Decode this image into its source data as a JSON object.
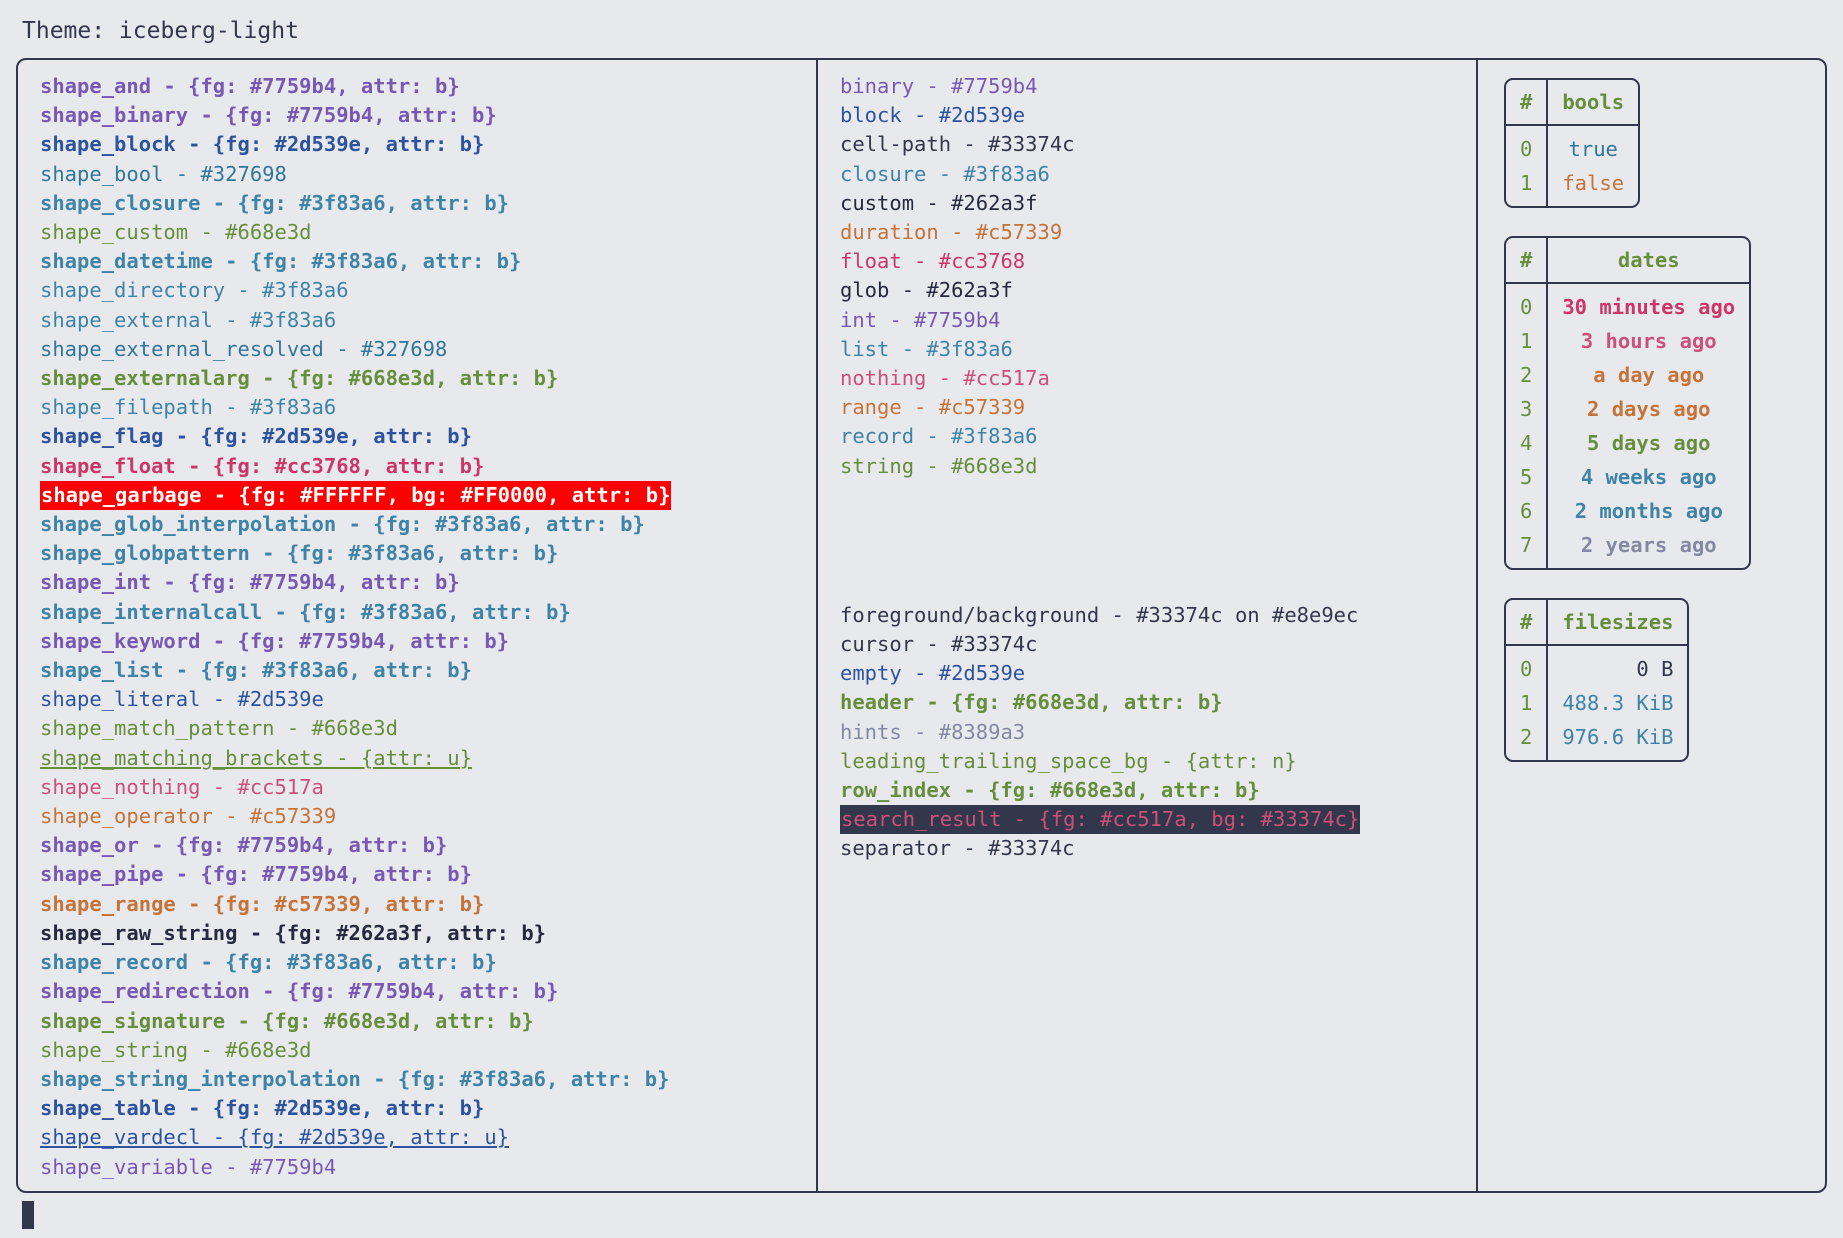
{
  "header": {
    "theme_label": "Theme: iceberg-light"
  },
  "palette": {
    "bg": "#e8e9ec",
    "fg": "#33374c",
    "purple": "#7759b4",
    "blue": "#2d539e",
    "teal": "#327698",
    "cyan": "#3f83a6",
    "green": "#668e3d",
    "pink": "#cc3768",
    "red_pink": "#cc517a",
    "orange": "#c57339",
    "black": "#262a3f",
    "grey": "#8389a3",
    "garbage_fg": "#FFFFFF",
    "garbage_bg": "#FF0000",
    "search_fg": "#cc517a",
    "search_bg": "#33374c"
  },
  "shapes_column": [
    {
      "text": "shape_and - {fg: #7759b4, attr: b}",
      "color": "#7759b4",
      "bold": true
    },
    {
      "text": "shape_binary - {fg: #7759b4, attr: b}",
      "color": "#7759b4",
      "bold": true
    },
    {
      "text": "shape_block - {fg: #2d539e, attr: b}",
      "color": "#2d539e",
      "bold": true
    },
    {
      "text": "shape_bool - #327698",
      "color": "#327698",
      "bold": false
    },
    {
      "text": "shape_closure - {fg: #3f83a6, attr: b}",
      "color": "#3f83a6",
      "bold": true
    },
    {
      "text": "shape_custom - #668e3d",
      "color": "#668e3d",
      "bold": false
    },
    {
      "text": "shape_datetime - {fg: #3f83a6, attr: b}",
      "color": "#3f83a6",
      "bold": true
    },
    {
      "text": "shape_directory - #3f83a6",
      "color": "#3f83a6",
      "bold": false
    },
    {
      "text": "shape_external - #3f83a6",
      "color": "#3f83a6",
      "bold": false
    },
    {
      "text": "shape_external_resolved - #327698",
      "color": "#327698",
      "bold": false
    },
    {
      "text": "shape_externalarg - {fg: #668e3d, attr: b}",
      "color": "#668e3d",
      "bold": true
    },
    {
      "text": "shape_filepath - #3f83a6",
      "color": "#3f83a6",
      "bold": false
    },
    {
      "text": "shape_flag - {fg: #2d539e, attr: b}",
      "color": "#2d539e",
      "bold": true
    },
    {
      "text": "shape_float - {fg: #cc3768, attr: b}",
      "color": "#cc3768",
      "bold": true
    },
    {
      "text": "shape_garbage - {fg: #FFFFFF, bg: #FF0000, attr: b}",
      "color": "#FFFFFF",
      "bg": "#FF0000",
      "bold": true
    },
    {
      "text": "shape_glob_interpolation - {fg: #3f83a6, attr: b}",
      "color": "#3f83a6",
      "bold": true
    },
    {
      "text": "shape_globpattern - {fg: #3f83a6, attr: b}",
      "color": "#3f83a6",
      "bold": true
    },
    {
      "text": "shape_int - {fg: #7759b4, attr: b}",
      "color": "#7759b4",
      "bold": true
    },
    {
      "text": "shape_internalcall - {fg: #3f83a6, attr: b}",
      "color": "#3f83a6",
      "bold": true
    },
    {
      "text": "shape_keyword - {fg: #7759b4, attr: b}",
      "color": "#7759b4",
      "bold": true
    },
    {
      "text": "shape_list - {fg: #3f83a6, attr: b}",
      "color": "#3f83a6",
      "bold": true
    },
    {
      "text": "shape_literal - #2d539e",
      "color": "#2d539e",
      "bold": false
    },
    {
      "text": "shape_match_pattern - #668e3d",
      "color": "#668e3d",
      "bold": false
    },
    {
      "text": "shape_matching_brackets - {attr: u}",
      "color": "#668e3d",
      "bold": false,
      "underline": true
    },
    {
      "text": "shape_nothing - #cc517a",
      "color": "#cc517a",
      "bold": false
    },
    {
      "text": "shape_operator - #c57339",
      "color": "#c57339",
      "bold": false
    },
    {
      "text": "shape_or - {fg: #7759b4, attr: b}",
      "color": "#7759b4",
      "bold": true
    },
    {
      "text": "shape_pipe - {fg: #7759b4, attr: b}",
      "color": "#7759b4",
      "bold": true
    },
    {
      "text": "shape_range - {fg: #c57339, attr: b}",
      "color": "#c57339",
      "bold": true
    },
    {
      "text": "shape_raw_string - {fg: #262a3f, attr: b}",
      "color": "#262a3f",
      "bold": true
    },
    {
      "text": "shape_record - {fg: #3f83a6, attr: b}",
      "color": "#3f83a6",
      "bold": true
    },
    {
      "text": "shape_redirection - {fg: #7759b4, attr: b}",
      "color": "#7759b4",
      "bold": true
    },
    {
      "text": "shape_signature - {fg: #668e3d, attr: b}",
      "color": "#668e3d",
      "bold": true
    },
    {
      "text": "shape_string - #668e3d",
      "color": "#668e3d",
      "bold": false
    },
    {
      "text": "shape_string_interpolation - {fg: #3f83a6, attr: b}",
      "color": "#3f83a6",
      "bold": true
    },
    {
      "text": "shape_table - {fg: #2d539e, attr: b}",
      "color": "#2d539e",
      "bold": true
    },
    {
      "text": "shape_vardecl - {fg: #2d539e, attr: u}",
      "color": "#2d539e",
      "bold": false,
      "underline": true
    },
    {
      "text": "shape_variable - #7759b4",
      "color": "#7759b4",
      "bold": false
    }
  ],
  "types_column": [
    {
      "text": "binary - #7759b4",
      "color": "#7759b4",
      "bold": false
    },
    {
      "text": "block - #2d539e",
      "color": "#2d539e",
      "bold": false
    },
    {
      "text": "cell-path - #33374c",
      "color": "#33374c",
      "bold": false
    },
    {
      "text": "closure - #3f83a6",
      "color": "#3f83a6",
      "bold": false
    },
    {
      "text": "custom - #262a3f",
      "color": "#262a3f",
      "bold": false
    },
    {
      "text": "duration - #c57339",
      "color": "#c57339",
      "bold": false
    },
    {
      "text": "float - #cc3768",
      "color": "#cc3768",
      "bold": false
    },
    {
      "text": "glob - #262a3f",
      "color": "#262a3f",
      "bold": false
    },
    {
      "text": "int - #7759b4",
      "color": "#7759b4",
      "bold": false
    },
    {
      "text": "list - #3f83a6",
      "color": "#3f83a6",
      "bold": false
    },
    {
      "text": "nothing - #cc517a",
      "color": "#cc517a",
      "bold": false
    },
    {
      "text": "range - #c57339",
      "color": "#c57339",
      "bold": false
    },
    {
      "text": "record - #3f83a6",
      "color": "#3f83a6",
      "bold": false
    },
    {
      "text": "string - #668e3d",
      "color": "#668e3d",
      "bold": false
    }
  ],
  "ui_column": [
    {
      "text": "foreground/background - #33374c on #e8e9ec",
      "color": "#33374c",
      "bold": false
    },
    {
      "text": "cursor - #33374c",
      "color": "#33374c",
      "bold": false
    },
    {
      "text": "empty - #2d539e",
      "color": "#2d539e",
      "bold": false
    },
    {
      "text": "header - {fg: #668e3d, attr: b}",
      "color": "#668e3d",
      "bold": true
    },
    {
      "text": "hints - #8389a3",
      "color": "#8389a3",
      "bold": false
    },
    {
      "text": "leading_trailing_space_bg - {attr: n}",
      "color": "#668e3d",
      "bold": false
    },
    {
      "text": "row_index - {fg: #668e3d, attr: b}",
      "color": "#668e3d",
      "bold": true
    },
    {
      "text": "search_result - {fg: #cc517a, bg: #33374c}",
      "color": "#cc517a",
      "bg": "#33374c",
      "bold": false
    },
    {
      "text": "separator - #33374c",
      "color": "#33374c",
      "bold": false
    }
  ],
  "tables": [
    {
      "name": "bools",
      "index_header": "#",
      "value_header": "bools",
      "align": "center",
      "rows": [
        {
          "index": "0",
          "value": "true",
          "color": "#327698"
        },
        {
          "index": "1",
          "value": "false",
          "color": "#c57339"
        }
      ]
    },
    {
      "name": "dates",
      "index_header": "#",
      "value_header": "dates",
      "align": "center",
      "rows": [
        {
          "index": "0",
          "value": "30 minutes ago",
          "color": "#cc3768",
          "bold": true
        },
        {
          "index": "1",
          "value": "3 hours ago",
          "color": "#cc517a",
          "bold": true
        },
        {
          "index": "2",
          "value": "a day ago",
          "color": "#c57339",
          "bold": true
        },
        {
          "index": "3",
          "value": "2 days ago",
          "color": "#c57339",
          "bold": true
        },
        {
          "index": "4",
          "value": "5 days ago",
          "color": "#668e3d",
          "bold": true
        },
        {
          "index": "5",
          "value": "4 weeks ago",
          "color": "#3f83a6",
          "bold": true
        },
        {
          "index": "6",
          "value": "2 months ago",
          "color": "#3f83a6",
          "bold": true
        },
        {
          "index": "7",
          "value": "2 years ago",
          "color": "#8389a3",
          "bold": true
        }
      ]
    },
    {
      "name": "filesizes",
      "index_header": "#",
      "value_header": "filesizes",
      "align": "right",
      "rows": [
        {
          "index": "0",
          "value": "0 B",
          "color": "#33374c"
        },
        {
          "index": "1",
          "value": "488.3 KiB",
          "color": "#3f83a6"
        },
        {
          "index": "2",
          "value": "976.6 KiB",
          "color": "#3f83a6"
        }
      ]
    }
  ]
}
